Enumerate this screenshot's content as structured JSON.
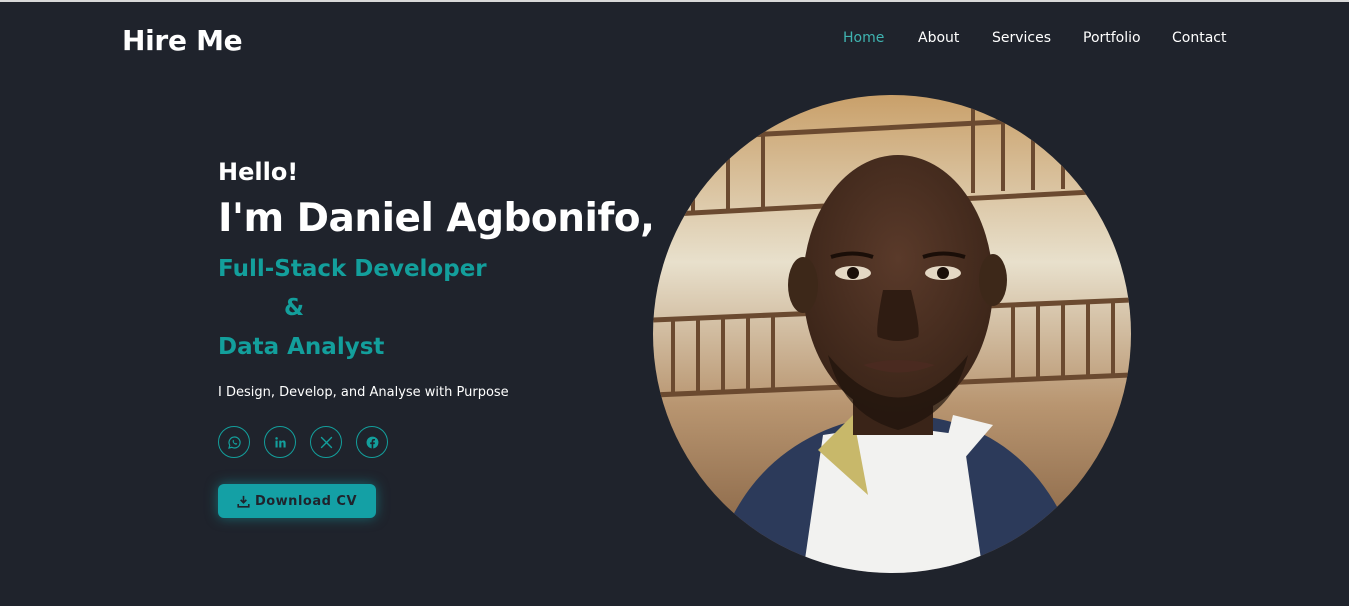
{
  "brand": {
    "logo_text": "Hire Me"
  },
  "nav": {
    "items": [
      {
        "label": "Home",
        "active": true
      },
      {
        "label": "About",
        "active": false
      },
      {
        "label": "Services",
        "active": false
      },
      {
        "label": "Portfolio",
        "active": false
      },
      {
        "label": "Contact",
        "active": false
      }
    ]
  },
  "hero": {
    "greeting": "Hello!",
    "name": "I'm Daniel Agbonifo,",
    "role_1": "Full-Stack Developer",
    "ampersand": "&",
    "role_2": "Data Analyst",
    "tagline": "I Design, Develop, and Analyse with Purpose",
    "socials": [
      "whatsapp-icon",
      "linkedin-icon",
      "x-icon",
      "facebook-icon"
    ],
    "cv_button": "Download CV"
  },
  "colors": {
    "background": "#1f232c",
    "accent": "#139f9c",
    "nav_active": "#3fb3b0",
    "button": "#14a0a5"
  }
}
